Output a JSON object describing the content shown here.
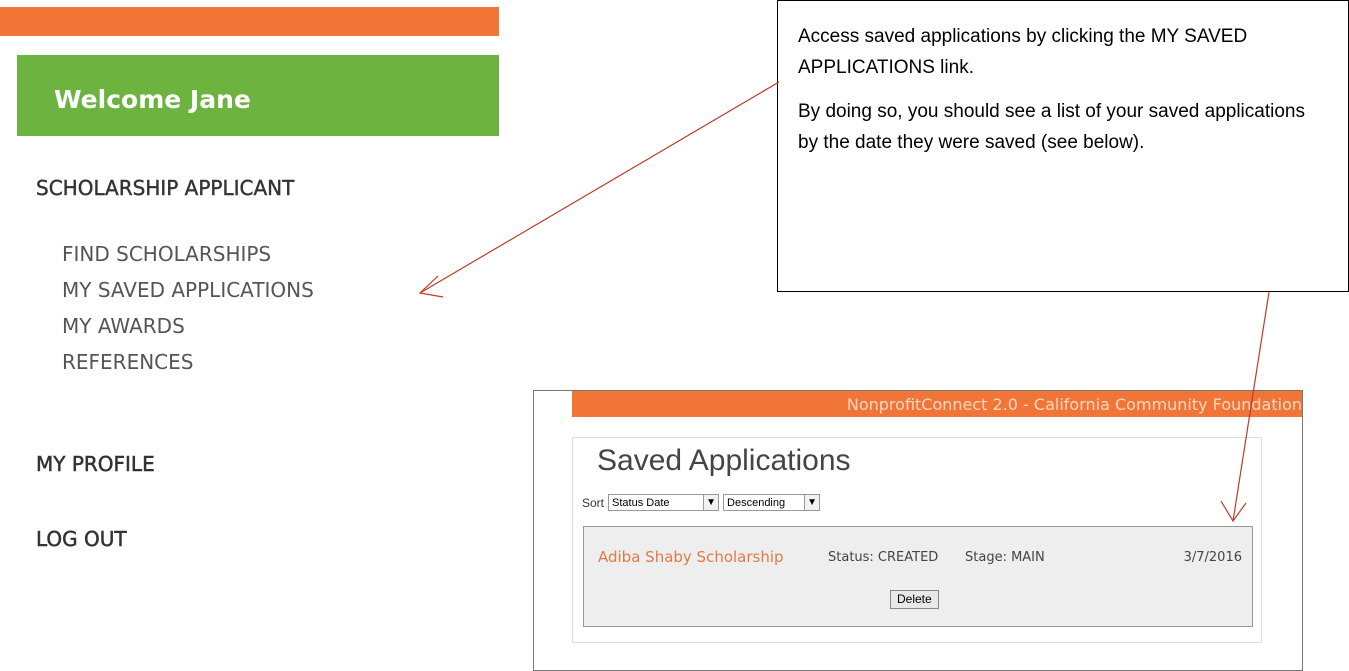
{
  "menu": {
    "welcome": "Welcome Jane",
    "applicant_heading": "SCHOLARSHIP APPLICANT",
    "items": [
      {
        "label": "FIND SCHOLARSHIPS"
      },
      {
        "label": "MY SAVED APPLICATIONS"
      },
      {
        "label": "MY AWARDS"
      },
      {
        "label": "REFERENCES"
      }
    ],
    "profile": "MY PROFILE",
    "logout": "LOG OUT"
  },
  "callout": {
    "paragraph1": "Access saved applications by clicking the MY SAVED APPLICATIONS link.",
    "paragraph2": "By doing so, you should see a list of your saved applications by the date they were saved (see below)."
  },
  "panel": {
    "banner": "NonprofitConnect 2.0 - California Community Foundation",
    "title": "Saved Applications",
    "sort_label": "Sort",
    "sort_field": "Status Date",
    "sort_order": "Descending",
    "application": {
      "name": "Adiba Shaby Scholarship",
      "status": "Status: CREATED",
      "stage": "Stage: MAIN",
      "date": "3/7/2016",
      "delete_label": "Delete"
    }
  },
  "colors": {
    "orange": "#f07537",
    "green": "#6db33f",
    "arrow": "#c0392b"
  }
}
